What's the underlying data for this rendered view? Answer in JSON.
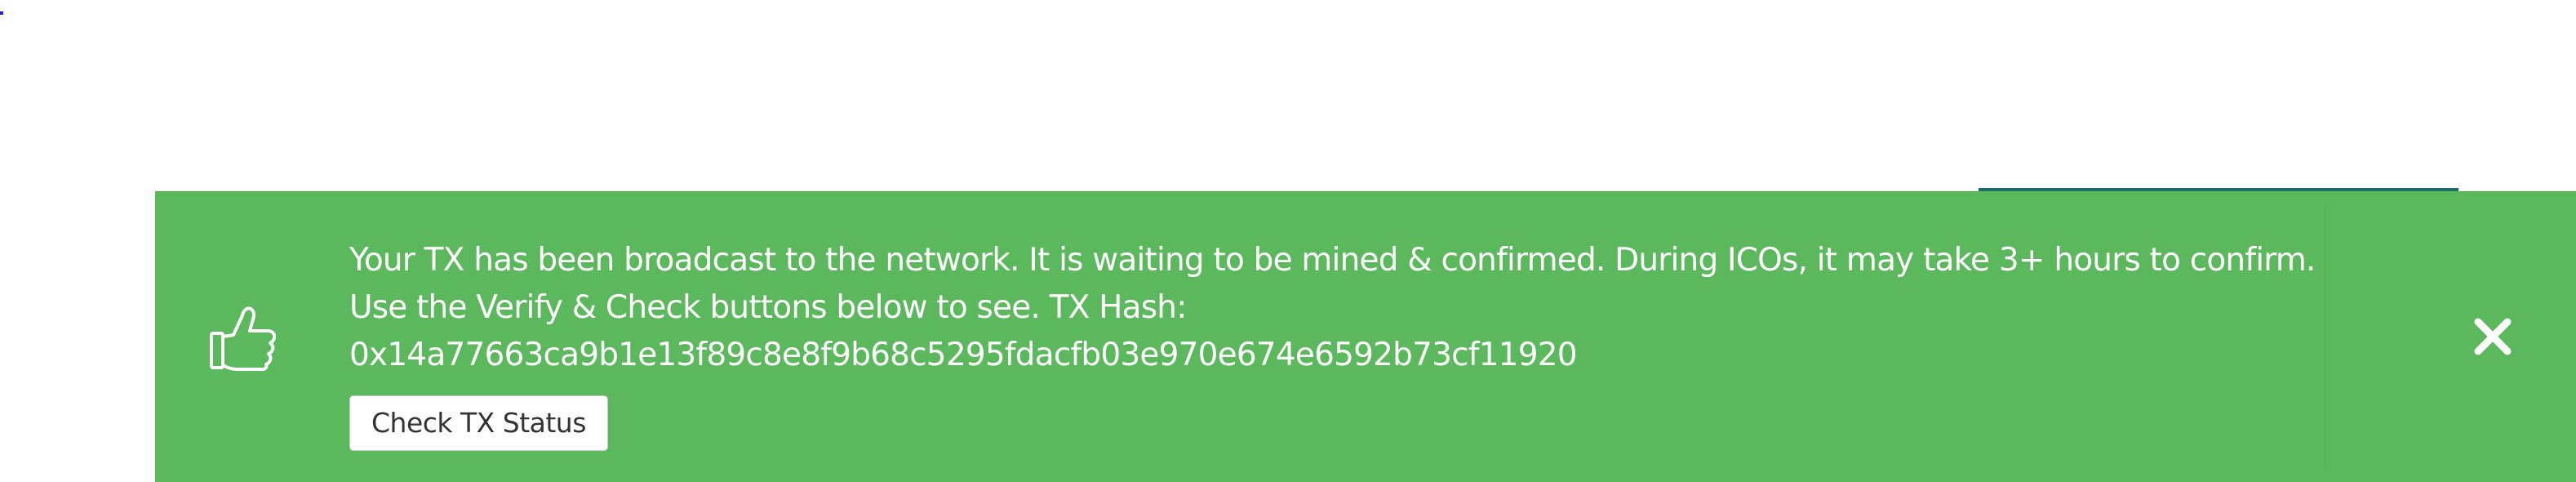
{
  "alert": {
    "type": "success",
    "color": "#5cb85c",
    "icon": "thumbs-up-icon",
    "message_line1": "Your TX has been broadcast to the network. It is waiting to be mined & confirmed. During ICOs, it may take 3+ hours to confirm.",
    "message_line2": "Use the Verify & Check buttons below to see. TX Hash:",
    "tx_hash": "0x14a77663ca9b1e13f89c8e8f9b68c5295fdacfb03e970e674e6592b73cf11920",
    "check_button_label": "Check TX Status",
    "close_icon": "close-icon"
  }
}
